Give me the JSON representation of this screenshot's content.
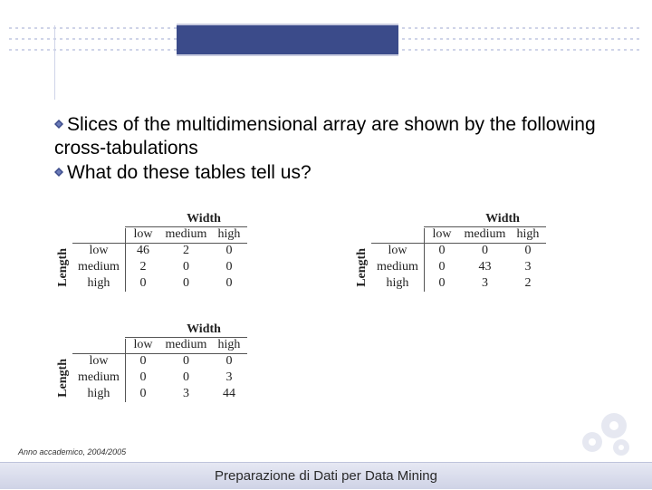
{
  "content": {
    "bullet1": "Slices of the multidimensional array are shown by the following cross-tabulations",
    "bullet2": "What do these tables tell us?"
  },
  "tables": {
    "width_label": "Width",
    "length_label": "Length",
    "cols": [
      "low",
      "medium",
      "high"
    ],
    "rows": [
      "low",
      "medium",
      "high"
    ],
    "t1": [
      [
        46,
        2,
        0
      ],
      [
        2,
        0,
        0
      ],
      [
        0,
        0,
        0
      ]
    ],
    "t2": [
      [
        0,
        0,
        0
      ],
      [
        0,
        43,
        3
      ],
      [
        0,
        3,
        2
      ]
    ],
    "t3": [
      [
        0,
        0,
        0
      ],
      [
        0,
        0,
        3
      ],
      [
        0,
        3,
        44
      ]
    ]
  },
  "footer": {
    "year": "Anno accademico, 2004/2005",
    "title": "Preparazione di Dati per Data Mining"
  }
}
